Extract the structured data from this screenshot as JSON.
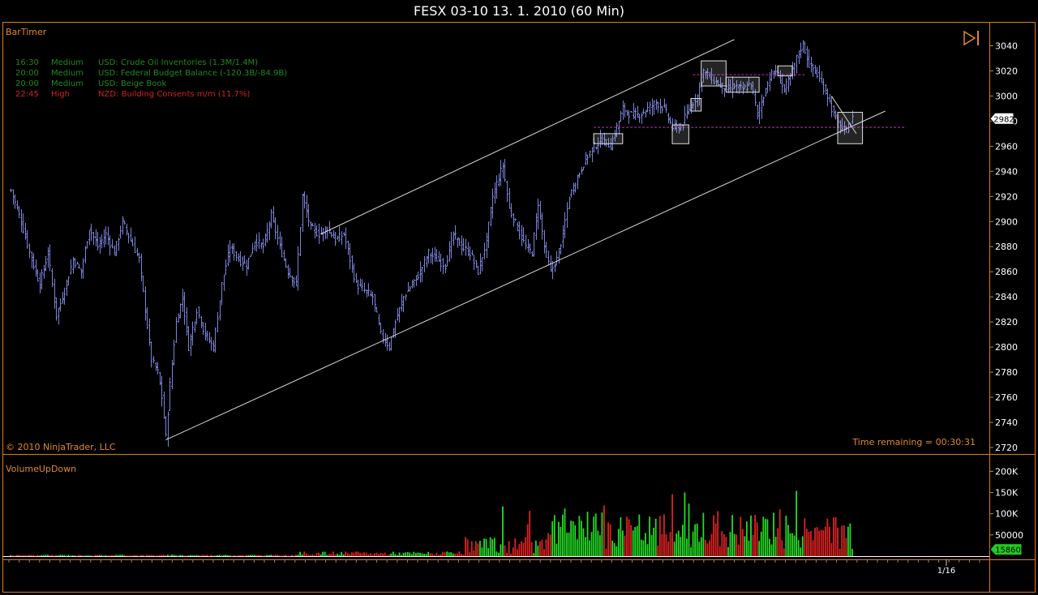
{
  "window": {
    "title": "FESX 03-10  13. 1. 2010 (60 Min)"
  },
  "price_panel": {
    "indicator_name": "BarTimer",
    "copyright": "© 2010 NinjaTrader, LLC",
    "time_remaining": "Time remaining = 00:30:31",
    "last_price_label": "2982",
    "news": [
      {
        "time": "16:30",
        "impact": "Medium",
        "text": "USD: Crude Oil Inventories (1.3M/1.4M)",
        "color": "#1f8a1f"
      },
      {
        "time": "20:00",
        "impact": "Medium",
        "text": "USD: Federal Budget Balance (-120.3B/-84.9B)",
        "color": "#1f8a1f"
      },
      {
        "time": "20:00",
        "impact": "Medium",
        "text": "USD: Beige Book",
        "color": "#1f8a1f"
      },
      {
        "time": "22:45",
        "impact": "High",
        "text": "NZD: Building Consents m/m (11.7%)",
        "color": "#d42020"
      }
    ]
  },
  "volume_panel": {
    "indicator_name": "VolumeUpDown",
    "last_volume_label": "15860",
    "date_label": "1/16"
  },
  "colors": {
    "frame": "#e07a1a",
    "price_bars": "#7b82d8",
    "up_volume": "#22dd22",
    "down_volume": "#dd2222",
    "channel": "#d8d8d8",
    "level_line": "#c030c0",
    "axis_text": "#ffffff",
    "label_text": "#e08a2a"
  },
  "chart_data": [
    {
      "type": "line",
      "description_series": "hourly price bars",
      "ylim": [
        2720,
        3050
      ],
      "yticks": [
        2720,
        2740,
        2760,
        2780,
        2800,
        2820,
        2840,
        2860,
        2880,
        2900,
        2920,
        2940,
        2960,
        2980,
        3000,
        3020,
        3040
      ],
      "keypoints": [
        [
          0,
          2925
        ],
        [
          5,
          2900
        ],
        [
          10,
          2870
        ],
        [
          14,
          2850
        ],
        [
          18,
          2875
        ],
        [
          22,
          2825
        ],
        [
          26,
          2845
        ],
        [
          30,
          2870
        ],
        [
          34,
          2860
        ],
        [
          38,
          2895
        ],
        [
          42,
          2880
        ],
        [
          46,
          2890
        ],
        [
          50,
          2875
        ],
        [
          54,
          2900
        ],
        [
          58,
          2885
        ],
        [
          62,
          2870
        ],
        [
          65,
          2830
        ],
        [
          68,
          2790
        ],
        [
          71,
          2780
        ],
        [
          73,
          2760
        ],
        [
          75,
          2728
        ],
        [
          77,
          2770
        ],
        [
          80,
          2820
        ],
        [
          83,
          2840
        ],
        [
          86,
          2800
        ],
        [
          90,
          2830
        ],
        [
          94,
          2810
        ],
        [
          98,
          2800
        ],
        [
          102,
          2850
        ],
        [
          106,
          2880
        ],
        [
          110,
          2870
        ],
        [
          114,
          2865
        ],
        [
          118,
          2885
        ],
        [
          122,
          2880
        ],
        [
          126,
          2905
        ],
        [
          130,
          2880
        ],
        [
          134,
          2860
        ],
        [
          138,
          2850
        ],
        [
          141,
          2920
        ],
        [
          145,
          2895
        ],
        [
          149,
          2890
        ],
        [
          153,
          2895
        ],
        [
          157,
          2885
        ],
        [
          161,
          2890
        ],
        [
          164,
          2870
        ],
        [
          167,
          2850
        ],
        [
          171,
          2845
        ],
        [
          175,
          2840
        ],
        [
          179,
          2810
        ],
        [
          183,
          2800
        ],
        [
          186,
          2820
        ],
        [
          190,
          2840
        ],
        [
          194,
          2850
        ],
        [
          198,
          2860
        ],
        [
          202,
          2875
        ],
        [
          206,
          2870
        ],
        [
          210,
          2865
        ],
        [
          214,
          2890
        ],
        [
          218,
          2880
        ],
        [
          222,
          2875
        ],
        [
          226,
          2860
        ],
        [
          230,
          2885
        ],
        [
          233,
          2920
        ],
        [
          236,
          2935
        ],
        [
          238,
          2945
        ],
        [
          241,
          2910
        ],
        [
          245,
          2895
        ],
        [
          249,
          2880
        ],
        [
          252,
          2875
        ],
        [
          255,
          2915
        ],
        [
          258,
          2880
        ],
        [
          261,
          2860
        ],
        [
          264,
          2870
        ],
        [
          267,
          2890
        ],
        [
          270,
          2920
        ],
        [
          274,
          2935
        ],
        [
          278,
          2950
        ],
        [
          282,
          2960
        ],
        [
          286,
          2965
        ],
        [
          290,
          2960
        ],
        [
          293,
          2975
        ],
        [
          296,
          2990
        ],
        [
          300,
          2985
        ],
        [
          304,
          2985
        ],
        [
          308,
          2990
        ],
        [
          312,
          2995
        ],
        [
          316,
          2990
        ],
        [
          320,
          2975
        ],
        [
          324,
          2975
        ],
        [
          328,
          2990
        ],
        [
          332,
          3000
        ],
        [
          335,
          3020
        ],
        [
          338,
          3015
        ],
        [
          342,
          3010
        ],
        [
          346,
          3005
        ],
        [
          350,
          3008
        ],
        [
          354,
          3005
        ],
        [
          358,
          3010
        ],
        [
          361,
          2985
        ],
        [
          364,
          3000
        ],
        [
          367,
          3015
        ],
        [
          370,
          3020
        ],
        [
          374,
          3005
        ],
        [
          377,
          3015
        ],
        [
          380,
          3030
        ],
        [
          383,
          3042
        ],
        [
          386,
          3025
        ],
        [
          389,
          3020
        ],
        [
          392,
          3010
        ],
        [
          395,
          3000
        ],
        [
          398,
          2985
        ],
        [
          401,
          2975
        ],
        [
          404,
          2972
        ],
        [
          407,
          2982
        ]
      ]
    },
    {
      "type": "bar",
      "description_series": "VolumeUpDown",
      "ylim": [
        0,
        220000
      ],
      "yticks": [
        50000,
        100000,
        150000,
        200000
      ],
      "ytick_labels": [
        "50000",
        "100K",
        "150K",
        "200K"
      ],
      "last_value": 15860
    }
  ]
}
